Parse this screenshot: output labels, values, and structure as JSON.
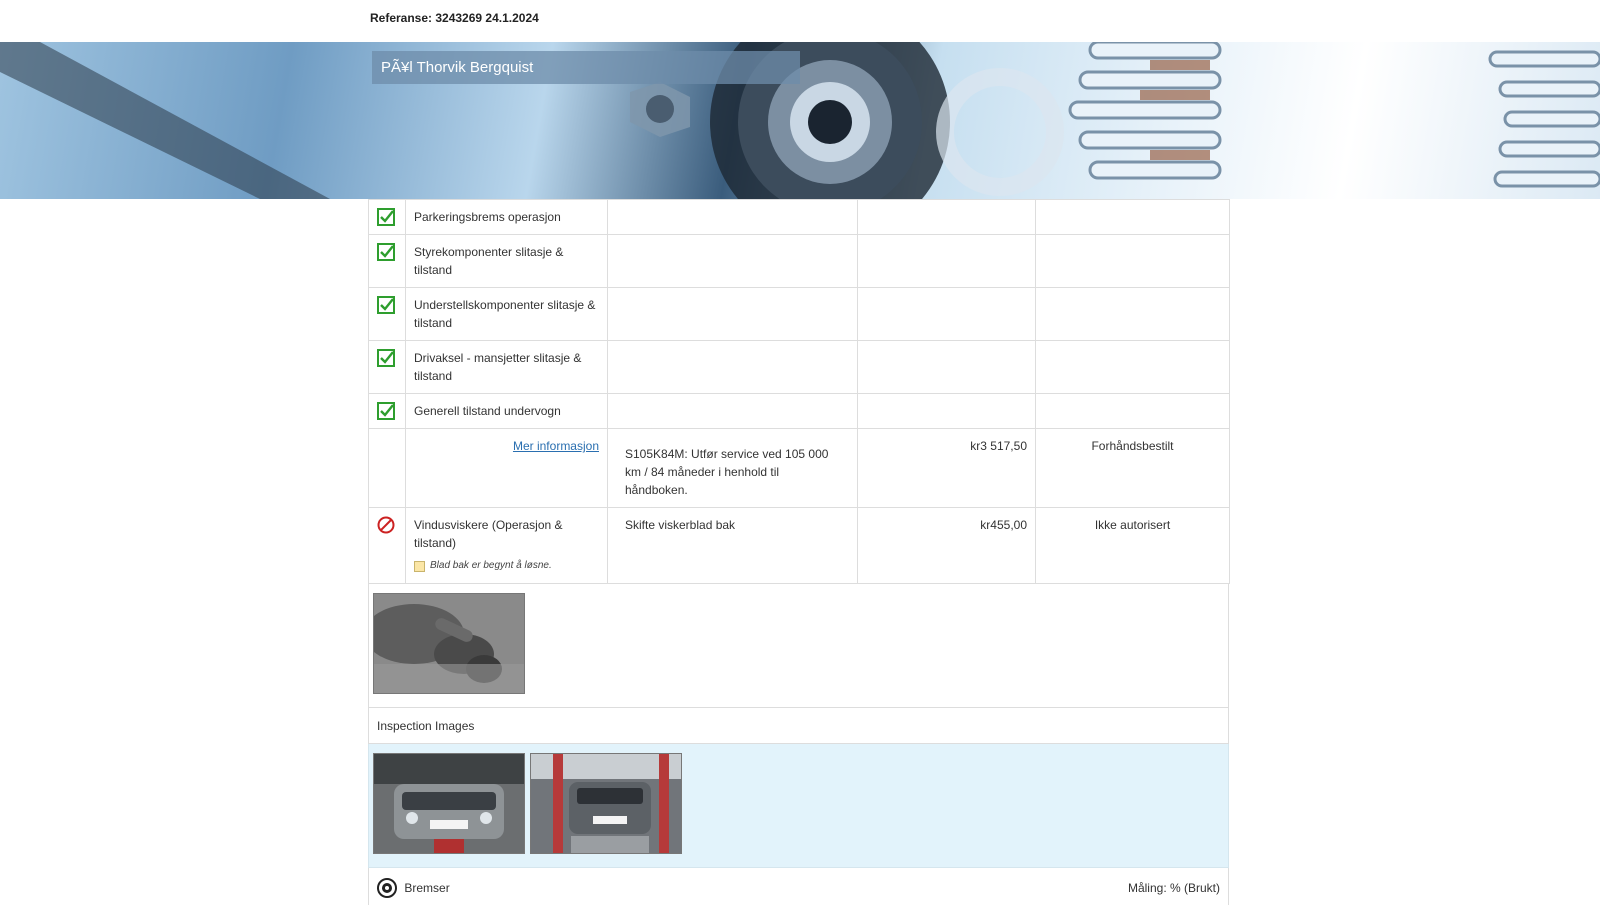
{
  "header": {
    "reference": "Referanse: 3243269 24.1.2024",
    "customer_name": "PÃ¥l Thorvik Bergquist"
  },
  "checklist": [
    {
      "status": "ok",
      "name": "Parkeringsbrems operasjon"
    },
    {
      "status": "ok",
      "name": "Styrekomponenter slitasje & tilstand"
    },
    {
      "status": "ok",
      "name": "Understellskomponenter slitasje & tilstand"
    },
    {
      "status": "ok",
      "name": "Drivaksel - mansjetter slitasje & tilstand"
    },
    {
      "status": "ok",
      "name": "Generell tilstand undervogn"
    }
  ],
  "service_row": {
    "link_label": "Mer informasjon",
    "description": "S105K84M: Utfør service ved 105 000 km / 84 måneder i henhold til håndboken.",
    "price": "kr3 517,50",
    "status": "Forhåndsbestilt"
  },
  "wiper_row": {
    "status_icon": "prohibited-icon",
    "name": "Vindusviskere (Operasjon & tilstand)",
    "note": "Blad bak er begynt å løsne.",
    "description": "Skifte viskerblad bak",
    "price": "kr455,00",
    "status": "Ikke autorisert"
  },
  "inspection": {
    "heading": "Inspection Images"
  },
  "brakes": {
    "label": "Bremser",
    "measure_label": "Måling: % (Brukt)"
  },
  "colors": {
    "check_green": "#2e9e2e",
    "prohibited_red": "#cc2222",
    "link_blue": "#2a6fb0",
    "inspection_bg": "#e2f3fb"
  }
}
